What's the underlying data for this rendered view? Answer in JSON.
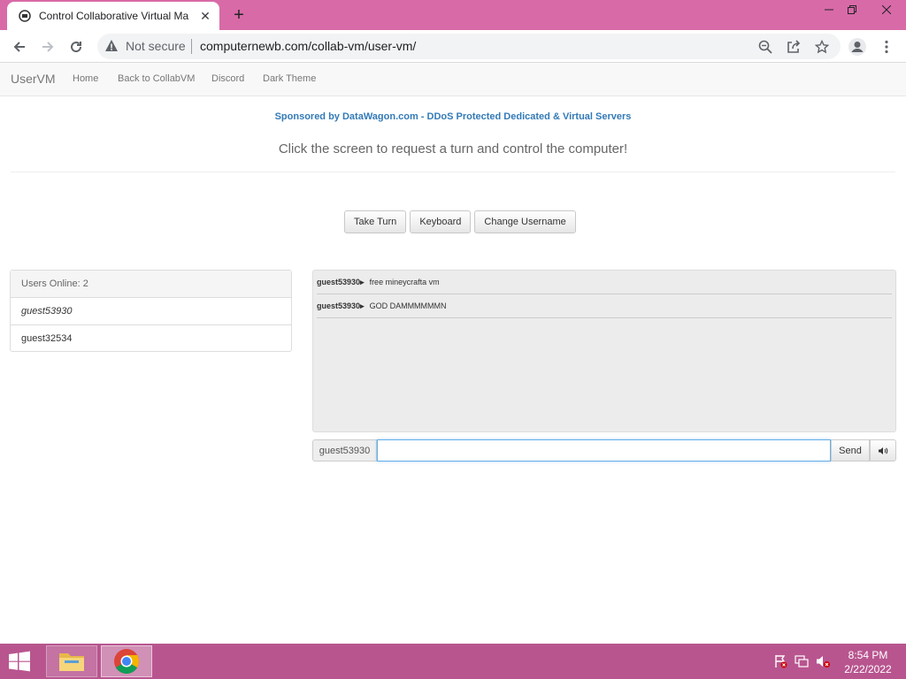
{
  "browser": {
    "tab_title": "Control Collaborative Virtual Ma",
    "security_label": "Not secure",
    "url": "computernewb.com/collab-vm/user-vm/"
  },
  "site_nav": {
    "brand": "UserVM",
    "links": [
      "Home",
      "Back to CollabVM",
      "Discord",
      "Dark Theme"
    ]
  },
  "sponsor_text": "Sponsored by DataWagon.com - DDoS Protected Dedicated & Virtual Servers",
  "headline": "Click the screen to request a turn and control the computer!",
  "buttons": {
    "take_turn": "Take Turn",
    "keyboard": "Keyboard",
    "change_username": "Change Username"
  },
  "users": {
    "heading": "Users Online: 2",
    "list": [
      "guest53930",
      "guest32534"
    ]
  },
  "chat": {
    "messages": [
      {
        "user": "guest53930▸",
        "text": "free mineycrafta vm"
      },
      {
        "user": "guest53930▸",
        "text": "GOD DAMMMMMMN"
      }
    ],
    "username": "guest53930",
    "input_value": "",
    "send_label": "Send"
  },
  "taskbar": {
    "time": "8:54 PM",
    "date": "2/22/2022"
  },
  "colors": {
    "tabstrip": "#d86aa8",
    "taskbar": "#b8558f",
    "sponsor_link": "#337ab7"
  }
}
